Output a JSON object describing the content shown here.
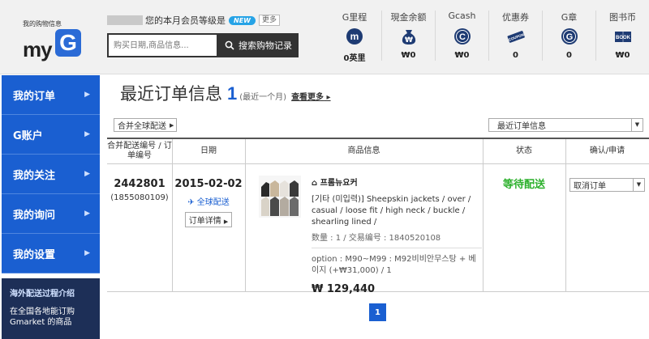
{
  "logo": {
    "sub": "我的购物信息",
    "my": "my",
    "g": "G"
  },
  "member": {
    "text": "您的本月会员等级是",
    "badge": "NEW",
    "more": "更多"
  },
  "search": {
    "placeholder": "购买日期,商品信息...",
    "button": "搜索购物记录"
  },
  "stats": [
    {
      "label": "G里程",
      "value": "0英里",
      "icon": "m-coin-icon",
      "glyph": "m"
    },
    {
      "label": "現金余额",
      "value": "₩0",
      "icon": "won-bag-icon",
      "glyph": "₩"
    },
    {
      "label": "Gcash",
      "value": "₩0",
      "icon": "gcash-coin-icon",
      "glyph": "C"
    },
    {
      "label": "优惠券",
      "value": "0",
      "icon": "coupon-ticket-icon",
      "glyph": "COUPON"
    },
    {
      "label": "G章",
      "value": "0",
      "icon": "g-stamp-icon",
      "glyph": "G"
    },
    {
      "label": "图书币",
      "value": "₩0",
      "icon": "book-icon",
      "glyph": "BOOK"
    }
  ],
  "sidebar": {
    "items": [
      {
        "label": "我的订单"
      },
      {
        "label": "G账户"
      },
      {
        "label": "我的关注"
      },
      {
        "label": "我的询问"
      },
      {
        "label": "我的设置"
      }
    ]
  },
  "promo": {
    "title": "海外配送过程介绍",
    "text": "在全国各地能订购 Gmarket 的商品"
  },
  "main": {
    "title": "最近订单信息",
    "count": "1",
    "period": "(最近一个月)",
    "view_more": "查看更多",
    "combine_select": "合并全球配送",
    "recent_select": "最近订单信息"
  },
  "table": {
    "headers": [
      "合并配送编号 / 订单编号",
      "日期",
      "商品信息",
      "状态",
      "确认/申请"
    ],
    "row": {
      "order_no": "2442801",
      "sub_no": "(1855080109)",
      "date": "2015-02-02",
      "ship": "全球配送",
      "detail_btn": "订单详情",
      "seller": "프롬뉴요커",
      "name": "[기타 (미입력)] Sheepskin jackets / over / casual / loose fit / high neck / buckle / shearling lined /",
      "qty": "数量 : 1 / 交易编号 : 1840520108",
      "option": "option : M90~M99 : M92비비안무스탕 + 베이지 (+₩31,000) / 1",
      "price": "₩ 129,440",
      "status": "等待配送",
      "action": "取消订单"
    }
  },
  "pager": {
    "current": "1"
  },
  "colors": {
    "accent": "#1a5fd1",
    "status": "#2bb02b"
  }
}
